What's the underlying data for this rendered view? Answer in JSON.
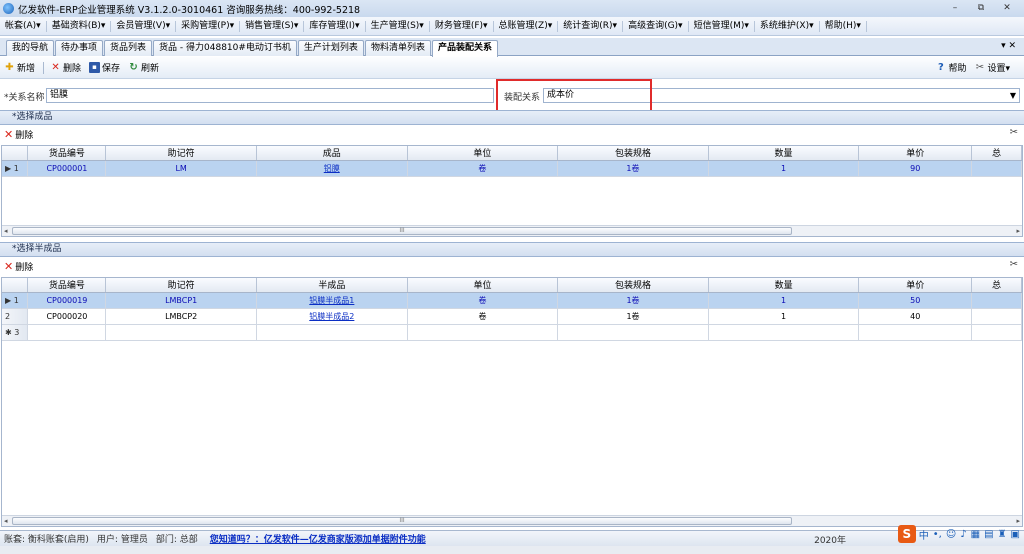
{
  "window": {
    "title": "亿发软件-ERP企业管理系统 V3.1.2.0-3010461 咨询服务热线：400-992-5218",
    "minimize": "–",
    "restore": "⧉",
    "close": "✕"
  },
  "menu": [
    "帐套(A)▾",
    "基础资料(B)▾",
    "会员管理(V)▾",
    "采购管理(P)▾",
    "销售管理(S)▾",
    "库存管理(I)▾",
    "生产管理(S)▾",
    "财务管理(F)▾",
    "总账管理(Z)▾",
    "统计查询(R)▾",
    "高级查询(G)▾",
    "短信管理(M)▾",
    "系统维护(X)▾",
    "帮助(H)▾"
  ],
  "tabs": [
    "我的导航",
    "待办事项",
    "货品列表",
    "货品 - 得力048810#电动订书机",
    "生产计划列表",
    "物料清单列表",
    "产品装配关系"
  ],
  "tab_controls": "▾ ✕",
  "toolbar": {
    "new": "新增",
    "delete": "删除",
    "save": "保存",
    "refresh": "刷新",
    "help": "帮助",
    "settings": "设置▾"
  },
  "form": {
    "name_label": "*关系名称",
    "name_value": "铝膜",
    "relation_label": "装配关系",
    "relation_value": "成本价"
  },
  "finished": {
    "section_title": "*选择成品",
    "delete_label": "删除",
    "columns": [
      "",
      "货品编号",
      "助记符",
      "成品",
      "单位",
      "包装规格",
      "数量",
      "单价",
      "总"
    ],
    "rows": [
      {
        "rh": "▶ 1",
        "code": "CP000001",
        "mnemonic": "LM",
        "product": "铝膜",
        "unit": "卷",
        "spec": "1卷",
        "qty": "1",
        "price": "90"
      }
    ],
    "scroll_mark": "III"
  },
  "semi": {
    "section_title": "*选择半成品",
    "delete_label": "删除",
    "columns": [
      "",
      "货品编号",
      "助记符",
      "半成品",
      "单位",
      "包装规格",
      "数量",
      "单价",
      "总"
    ],
    "rows": [
      {
        "rh": "▶ 1",
        "code": "CP000019",
        "mnemonic": "LMBCP1",
        "product": "铝膜半成品1",
        "unit": "卷",
        "spec": "1卷",
        "qty": "1",
        "price": "50"
      },
      {
        "rh": "2",
        "code": "CP000020",
        "mnemonic": "LMBCP2",
        "product": "铝膜半成品2",
        "unit": "卷",
        "spec": "1卷",
        "qty": "1",
        "price": "40"
      },
      {
        "rh": "✱ 3",
        "code": "",
        "mnemonic": "",
        "product": "",
        "unit": "",
        "spec": "",
        "qty": "",
        "price": ""
      }
    ],
    "scroll_mark": "III"
  },
  "status": {
    "account": "账套: 衡科账套(启用)",
    "user": "用户: 管理员",
    "dept": "部门: 总部",
    "tip": "您知道吗？：亿发软件—亿发商家版添加单据附件功能",
    "date": "2020年",
    "ime_s": "S",
    "ime_zh": "中"
  },
  "colors": {
    "selected_row": "#bad3f0",
    "link": "#0b2ec4",
    "highlight_box": "#e02b2b"
  }
}
